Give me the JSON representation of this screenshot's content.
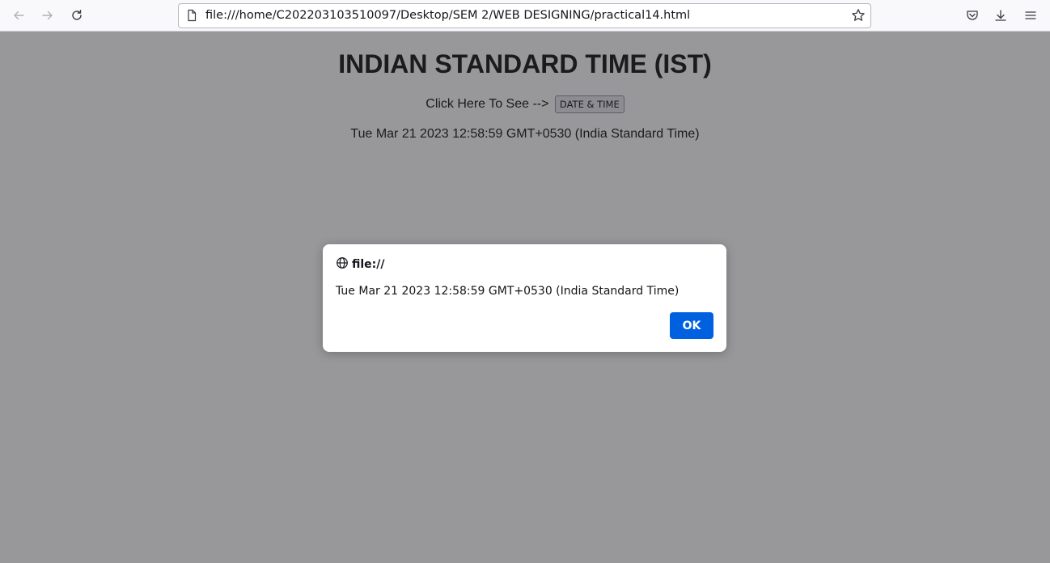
{
  "browser": {
    "url": "file:///home/C202203103510097/Desktop/SEM 2/WEB DESIGNING/practical14.html",
    "icons": {
      "back": "arrow-left-icon",
      "forward": "arrow-right-icon",
      "reload": "reload-icon",
      "page": "page-icon",
      "bookmark": "star-icon",
      "pocket": "pocket-icon",
      "downloads": "download-icon",
      "menu": "hamburger-menu-icon"
    }
  },
  "page": {
    "heading": "INDIAN STANDARD TIME (IST)",
    "prompt_text": "Click Here To See -->",
    "button_label": "DATE & TIME",
    "output_text": "Tue Mar 21 2023 12:58:59 GMT+0530 (India Standard Time)"
  },
  "alert": {
    "origin": "file://",
    "message": "Tue Mar 21 2023 12:58:59 GMT+0530 (India Standard Time)",
    "ok_label": "OK",
    "icon": "globe-icon",
    "accent_color": "#0061e0"
  }
}
